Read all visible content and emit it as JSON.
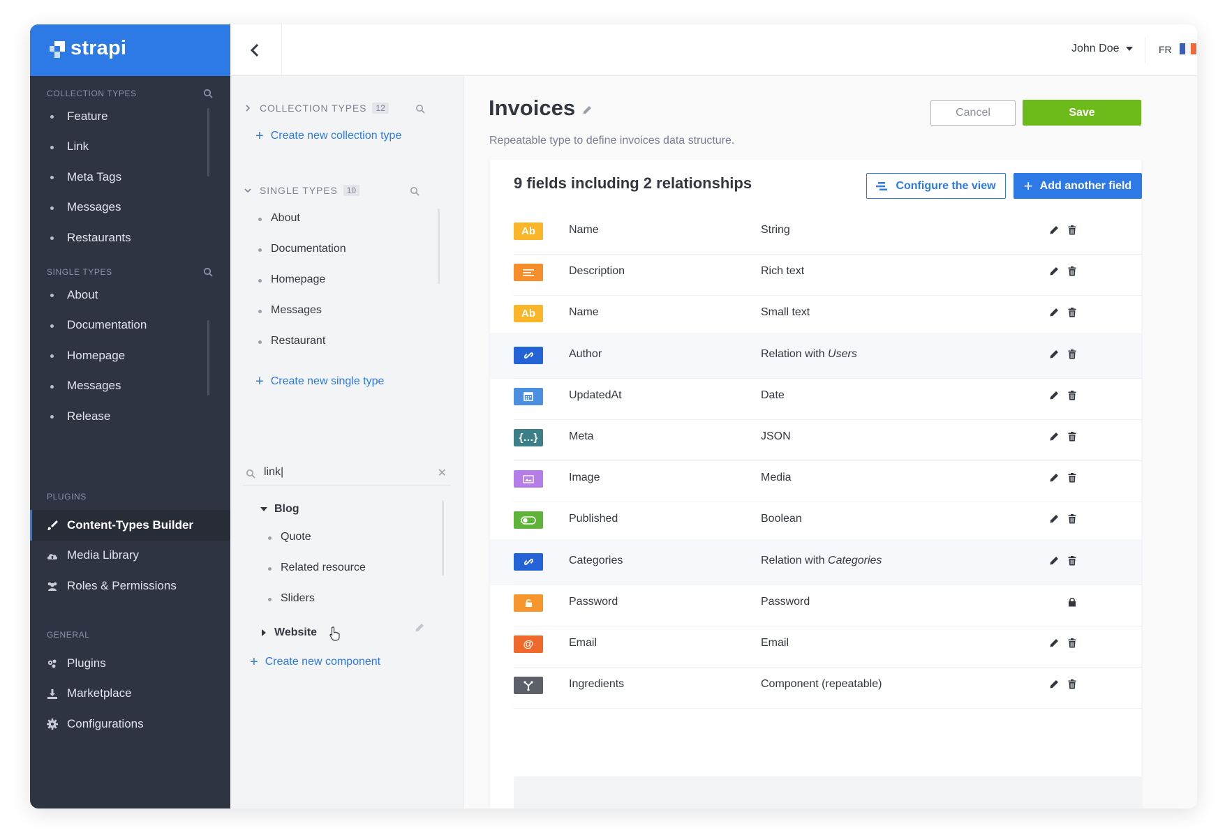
{
  "brand": {
    "name": "strapi"
  },
  "nav": {
    "collection_title": "COLLECTION TYPES",
    "collection_items": [
      {
        "label": "Feature"
      },
      {
        "label": "Link"
      },
      {
        "label": "Meta Tags"
      },
      {
        "label": "Messages"
      },
      {
        "label": "Restaurants"
      }
    ],
    "single_title": "SINGLE TYPES",
    "single_items": [
      {
        "label": "About"
      },
      {
        "label": "Documentation"
      },
      {
        "label": "Homepage"
      },
      {
        "label": "Messages"
      },
      {
        "label": "Release"
      }
    ],
    "plugins_title": "PLUGINS",
    "plugin_items": [
      {
        "label": "Content-Types Builder",
        "icon": "brush-icon"
      },
      {
        "label": "Media Library",
        "icon": "cloud-upload-icon"
      },
      {
        "label": "Roles & Permissions",
        "icon": "users-icon"
      }
    ],
    "general_title": "GENERAL",
    "general_items": [
      {
        "label": "Plugins",
        "icon": "puzzle-icon"
      },
      {
        "label": "Marketplace",
        "icon": "download-icon"
      },
      {
        "label": "Configurations",
        "icon": "gear-icon"
      }
    ]
  },
  "header": {
    "user": "John Doe",
    "lang": "FR"
  },
  "sidebar": {
    "collection": {
      "title": "COLLECTION TYPES",
      "count": "12",
      "create_label": "Create new collection type"
    },
    "single": {
      "title": "SINGLE TYPES",
      "count": "10",
      "items": [
        {
          "label": "About"
        },
        {
          "label": "Documentation"
        },
        {
          "label": "Homepage"
        },
        {
          "label": "Messages"
        },
        {
          "label": "Restaurant"
        }
      ],
      "create_label": "Create new single type"
    },
    "components": {
      "search_value": "link|",
      "groups": [
        {
          "label": "Blog",
          "items": [
            {
              "label": "Quote"
            },
            {
              "label": "Related resource"
            },
            {
              "label": "Sliders"
            }
          ]
        },
        {
          "label": "Website"
        }
      ],
      "create_label": "Create new component"
    }
  },
  "main": {
    "title": "Invoices",
    "subtitle": "Repeatable type to define invoices data structure.",
    "cancel_label": "Cancel",
    "save_label": "Save",
    "fields_summary": "9 fields including 2 relationships",
    "configure_label": "Configure the view",
    "add_field_label": "Add another field",
    "fields": [
      {
        "name": "Name",
        "type": "String",
        "type_em": "",
        "icon": "text-icon",
        "icon_label": "Ab",
        "color": "#fab528",
        "relation": false,
        "locked": false
      },
      {
        "name": "Description",
        "type": "Rich text",
        "type_em": "",
        "icon": "richtext-icon",
        "icon_label": "",
        "color": "#f68f2b",
        "relation": false,
        "locked": false
      },
      {
        "name": "Name",
        "type": "Small text",
        "type_em": "",
        "icon": "text-icon",
        "icon_label": "Ab",
        "color": "#fab528",
        "relation": false,
        "locked": false
      },
      {
        "name": "Author",
        "type": "Relation with ",
        "type_em": "Users",
        "icon": "relation-icon",
        "icon_label": "",
        "color": "#2463d6",
        "relation": true,
        "locked": false
      },
      {
        "name": "UpdatedAt",
        "type": "Date",
        "type_em": "",
        "icon": "calendar-icon",
        "icon_label": "",
        "color": "#4b8fe0",
        "relation": false,
        "locked": false
      },
      {
        "name": "Meta",
        "type": "JSON",
        "type_em": "",
        "icon": "json-icon",
        "icon_label": "{…}",
        "color": "#3c7f88",
        "relation": false,
        "locked": false
      },
      {
        "name": "Image",
        "type": "Media",
        "type_em": "",
        "icon": "media-icon",
        "icon_label": "",
        "color": "#b57de8",
        "relation": false,
        "locked": false
      },
      {
        "name": "Published",
        "type": "Boolean",
        "type_em": "",
        "icon": "toggle-icon",
        "icon_label": "",
        "color": "#5fb53a",
        "relation": false,
        "locked": false
      },
      {
        "name": "Categories",
        "type": "Relation with ",
        "type_em": "Categories",
        "icon": "relation-icon",
        "icon_label": "",
        "color": "#2463d6",
        "relation": true,
        "locked": false
      },
      {
        "name": "Password",
        "type": "Password",
        "type_em": "",
        "icon": "padlock-icon",
        "icon_label": "",
        "color": "#f6962d",
        "relation": false,
        "locked": true
      },
      {
        "name": "Email",
        "type": "Email",
        "type_em": "",
        "icon": "at-icon",
        "icon_label": "@",
        "color": "#ef6a2a",
        "relation": false,
        "locked": false
      },
      {
        "name": "Ingredients",
        "type": "Component (repeatable)",
        "type_em": "",
        "icon": "component-icon",
        "icon_label": "",
        "color": "#5b6069",
        "relation": false,
        "locked": false
      }
    ]
  },
  "colors": {
    "brand": "#2d7ae6",
    "save": "#6dbb1a",
    "nav_bg": "#2e3442"
  }
}
